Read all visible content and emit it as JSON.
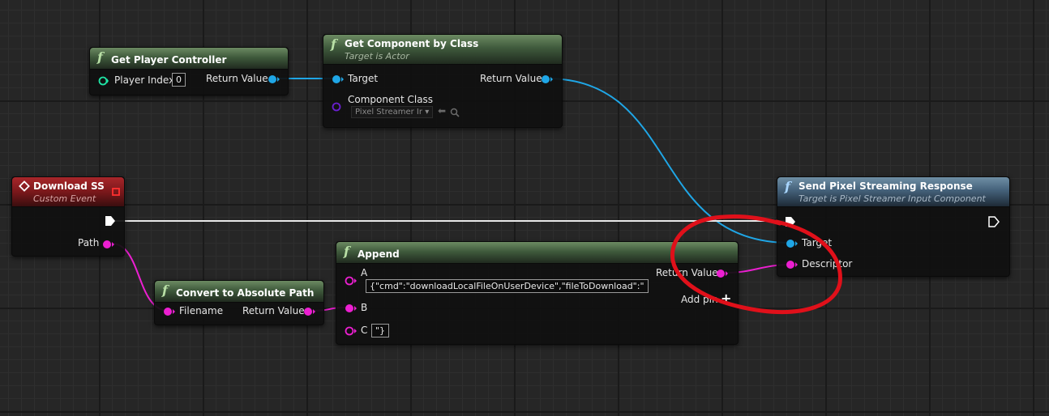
{
  "nodes": {
    "get_player_controller": {
      "title": "Get Player Controller",
      "player_index_label": "Player Index",
      "player_index_value": "0",
      "return_label": "Return Value"
    },
    "get_component_by_class": {
      "title": "Get Component by Class",
      "subtitle": "Target is Actor",
      "target_label": "Target",
      "component_class_label": "Component Class",
      "component_class_value": "Pixel Streamer Ir",
      "return_label": "Return Value"
    },
    "download_ss": {
      "title": "Download SS",
      "subtitle": "Custom Event",
      "path_label": "Path"
    },
    "send_response": {
      "title": "Send Pixel Streaming Response",
      "subtitle": "Target is Pixel Streamer Input Component",
      "target_label": "Target",
      "descriptor_label": "Descriptor"
    },
    "convert_path": {
      "title": "Convert to Absolute Path",
      "filename_label": "Filename",
      "return_label": "Return Value"
    },
    "append": {
      "title": "Append",
      "a_label": "A",
      "a_value": "{\"cmd\":\"downloadLocalFileOnUserDevice\",\"fileToDownload\":\"",
      "b_label": "B",
      "c_label": "C",
      "c_value": "\"}",
      "return_label": "Return Value",
      "add_pin_label": "Add pin"
    }
  },
  "colors": {
    "exec": "#ffffff",
    "object_pin": "#1fa6e6",
    "string_pin": "#ec1fd1",
    "class_pin": "#6a1fd1",
    "int_pin": "#1fe6a6",
    "annotation": "#e0101a"
  }
}
